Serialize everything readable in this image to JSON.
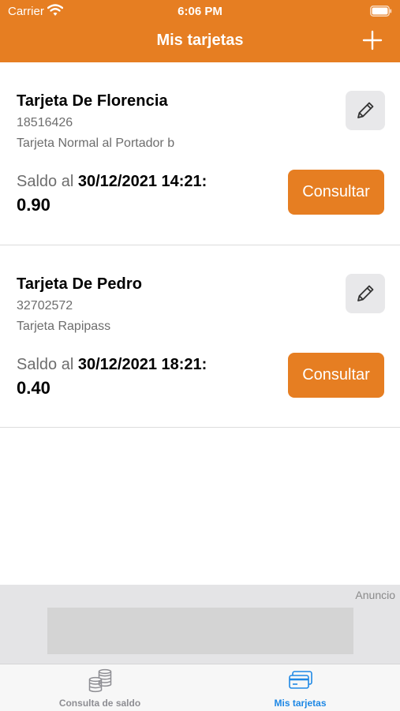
{
  "status_bar": {
    "carrier": "Carrier",
    "time": "6:06 PM"
  },
  "header": {
    "title": "Mis tarjetas"
  },
  "cards": [
    {
      "name": "Tarjeta De Florencia",
      "number": "18516426",
      "type": "Tarjeta Normal al Portador b",
      "balance_label": "Saldo al ",
      "balance_date": "30/12/2021 14:21:",
      "balance_value": "0.90",
      "consult_label": "Consultar"
    },
    {
      "name": "Tarjeta De Pedro",
      "number": "32702572",
      "type": "Tarjeta Rapipass",
      "balance_label": "Saldo al ",
      "balance_date": "30/12/2021 18:21:",
      "balance_value": "0.40",
      "consult_label": "Consultar"
    }
  ],
  "ad": {
    "label": "Anuncio"
  },
  "tabbar": {
    "tabs": [
      {
        "label": "Consulta de saldo",
        "icon": "coins-icon",
        "selected": false
      },
      {
        "label": "Mis tarjetas",
        "icon": "card-icon",
        "selected": true
      }
    ]
  },
  "colors": {
    "accent": "#e67e22",
    "tab_selected": "#1e88e5",
    "tab_unselected": "#8e8e93"
  }
}
